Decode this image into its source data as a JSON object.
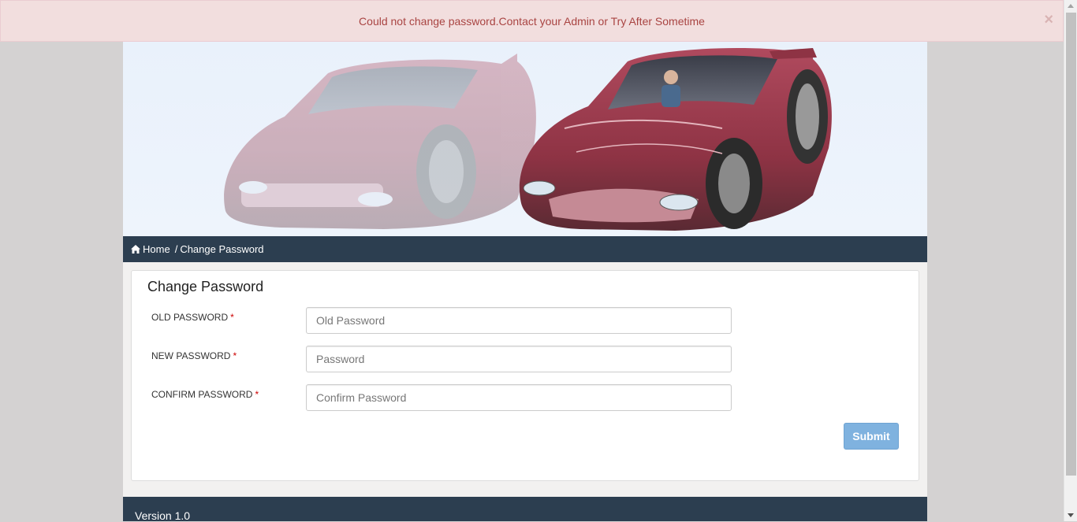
{
  "alert": {
    "message": "Could not change password.Contact your Admin or Try After Sometime",
    "close": "×"
  },
  "banner": {
    "image": "sports-car-xray-image",
    "background_color": "#e9f1fb"
  },
  "breadcrumb": {
    "home": "Home",
    "separator": "/",
    "current": "Change Password",
    "icon": "home-icon"
  },
  "form": {
    "title": "Change Password",
    "fields": [
      {
        "label": "OLD PASSWORD",
        "required": "*",
        "placeholder": "Old Password",
        "value": ""
      },
      {
        "label": "NEW PASSWORD",
        "required": "*",
        "placeholder": "Password",
        "value": ""
      },
      {
        "label": "CONFIRM PASSWORD",
        "required": "*",
        "placeholder": "Confirm Password",
        "value": ""
      }
    ],
    "submit_label": "Submit"
  },
  "footer": {
    "version": "Version 1.0"
  },
  "colors": {
    "navy": "#2c3e50",
    "alert_bg": "#f2dede",
    "alert_text": "#a94442",
    "submit_bg": "#7fb2df",
    "required": "#cc0000"
  }
}
